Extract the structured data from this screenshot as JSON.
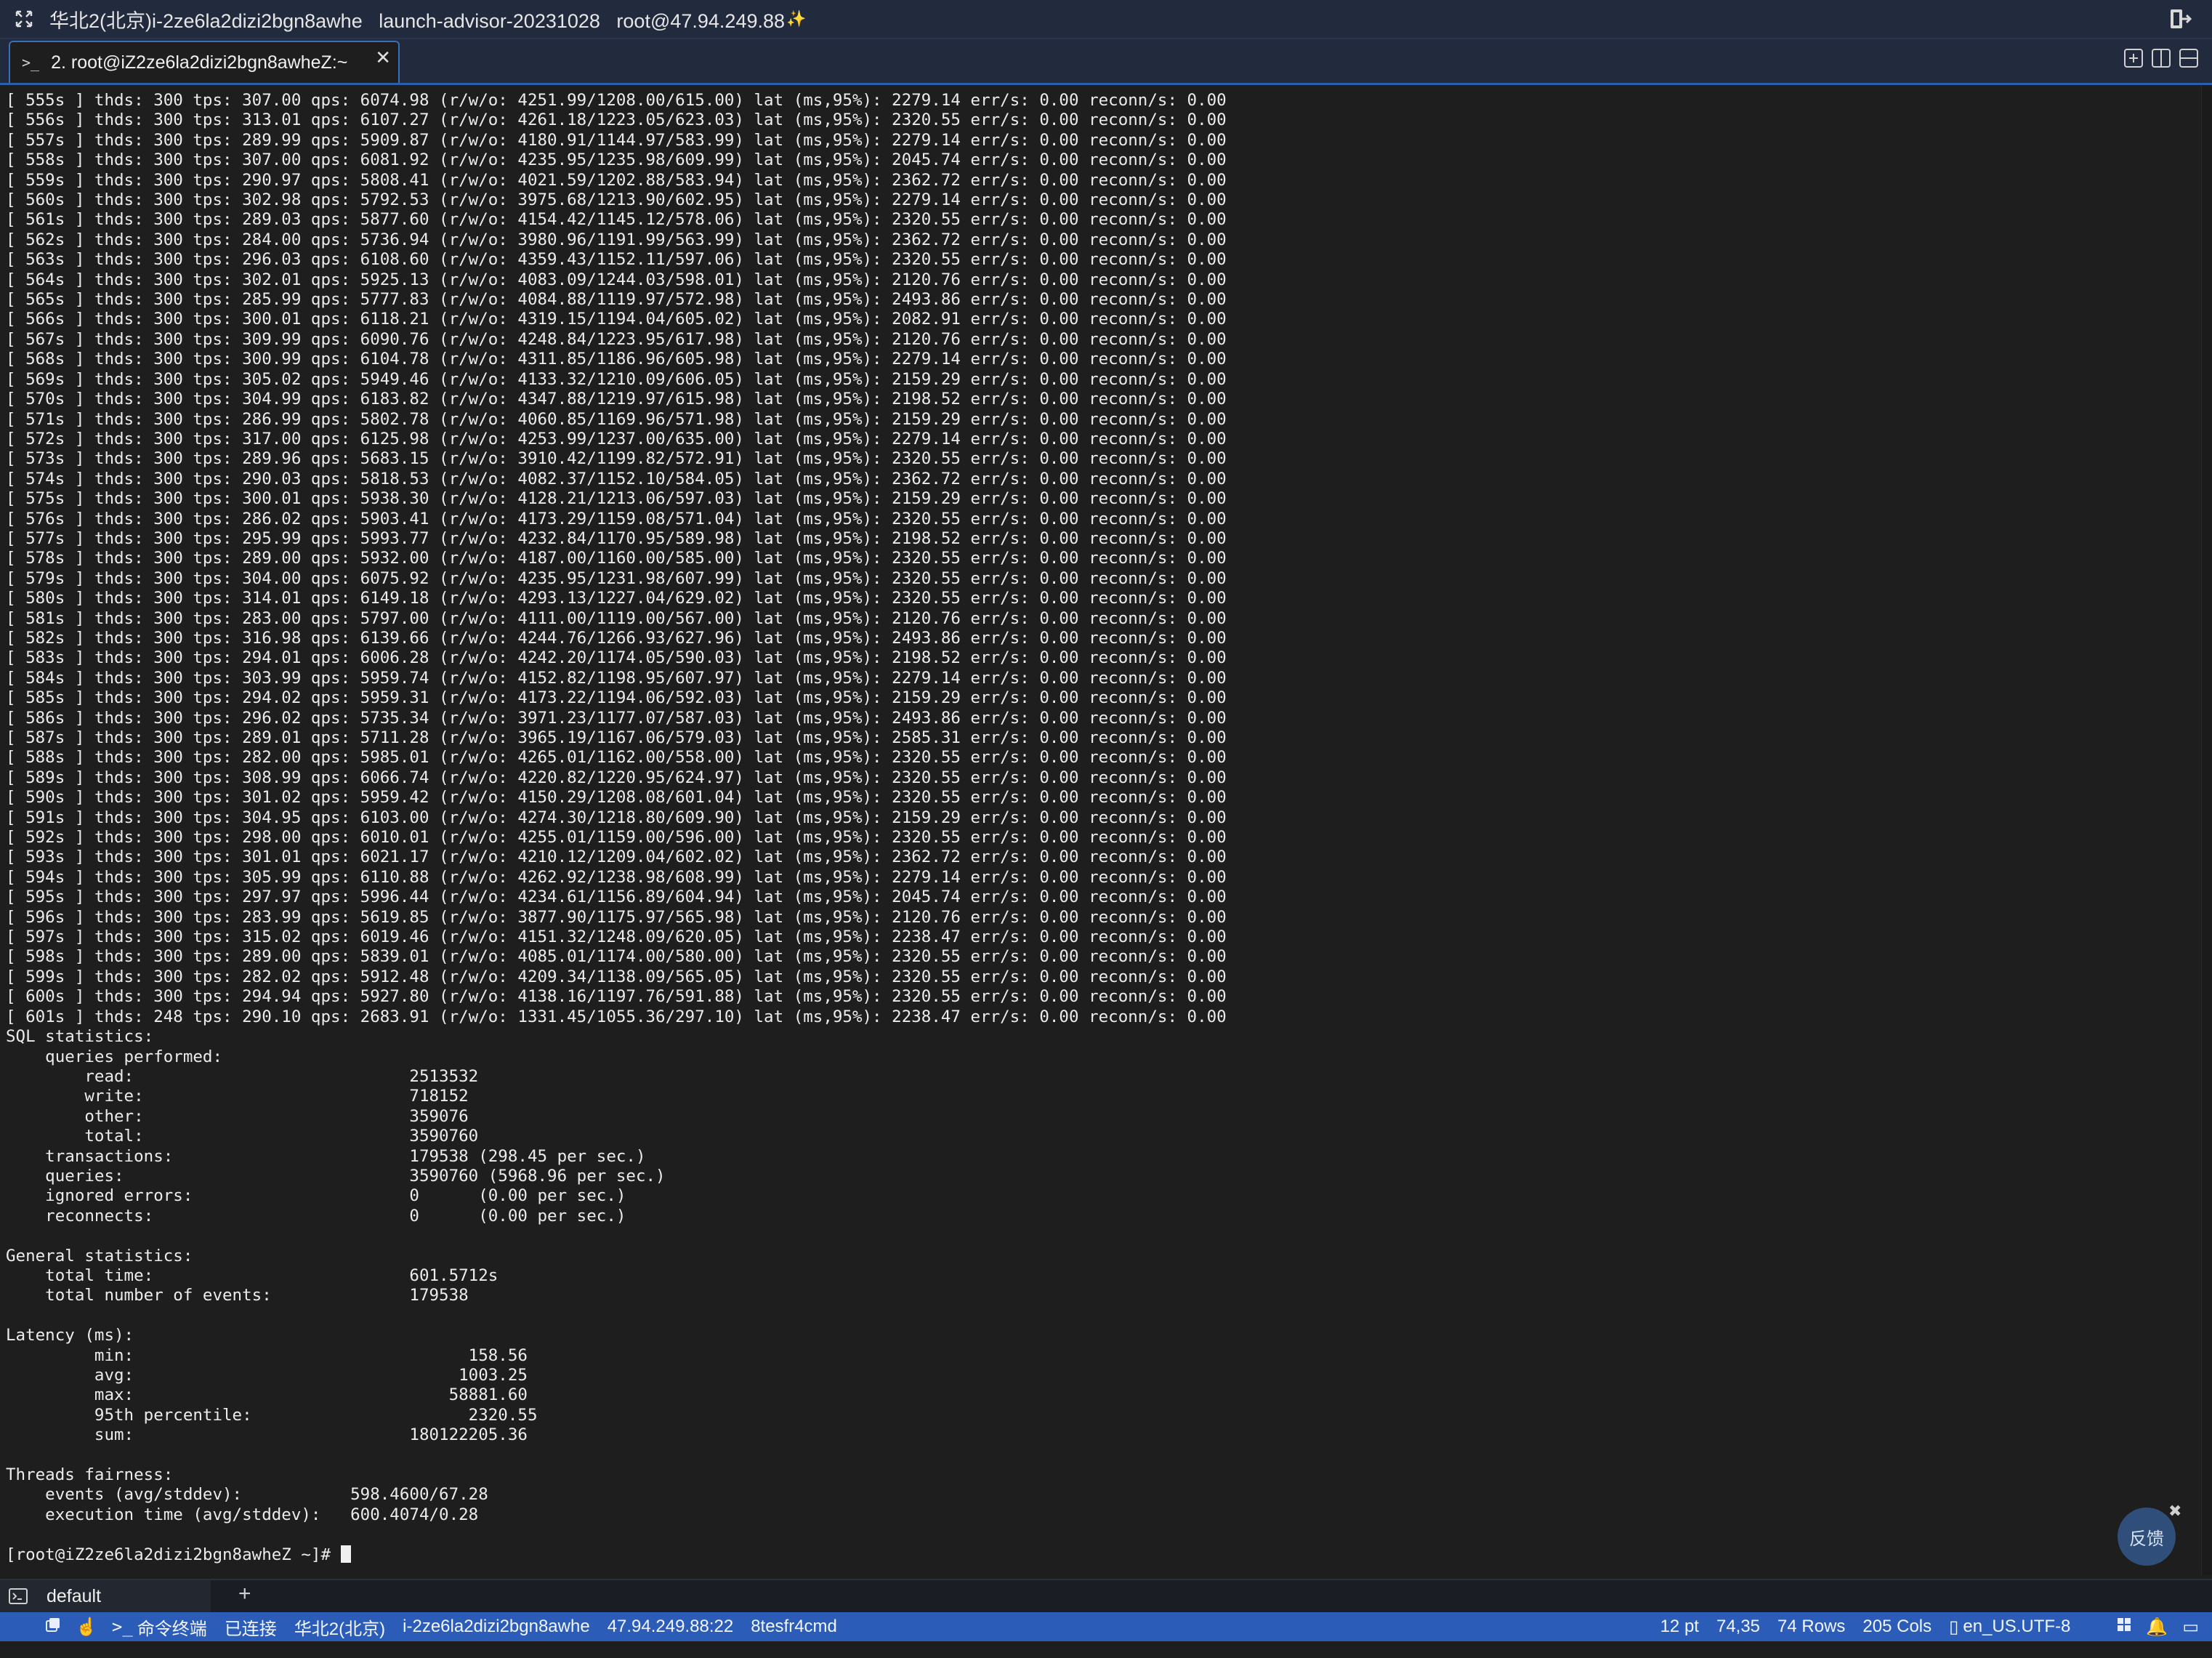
{
  "window": {
    "title": "华北2(北京)i-2ze6la2dizi2bgn8awhe   launch-advisor-20231028   root@47.94.249.88"
  },
  "tabs": [
    {
      "label": "2. root@iZ2ze6la2dizi2bgn8awheZ:~",
      "active": true
    }
  ],
  "terminal": {
    "lines": [
      "[ 555s ] thds: 300 tps: 307.00 qps: 6074.98 (r/w/o: 4251.99/1208.00/615.00) lat (ms,95%): 2279.14 err/s: 0.00 reconn/s: 0.00",
      "[ 556s ] thds: 300 tps: 313.01 qps: 6107.27 (r/w/o: 4261.18/1223.05/623.03) lat (ms,95%): 2320.55 err/s: 0.00 reconn/s: 0.00",
      "[ 557s ] thds: 300 tps: 289.99 qps: 5909.87 (r/w/o: 4180.91/1144.97/583.99) lat (ms,95%): 2279.14 err/s: 0.00 reconn/s: 0.00",
      "[ 558s ] thds: 300 tps: 307.00 qps: 6081.92 (r/w/o: 4235.95/1235.98/609.99) lat (ms,95%): 2045.74 err/s: 0.00 reconn/s: 0.00",
      "[ 559s ] thds: 300 tps: 290.97 qps: 5808.41 (r/w/o: 4021.59/1202.88/583.94) lat (ms,95%): 2362.72 err/s: 0.00 reconn/s: 0.00",
      "[ 560s ] thds: 300 tps: 302.98 qps: 5792.53 (r/w/o: 3975.68/1213.90/602.95) lat (ms,95%): 2279.14 err/s: 0.00 reconn/s: 0.00",
      "[ 561s ] thds: 300 tps: 289.03 qps: 5877.60 (r/w/o: 4154.42/1145.12/578.06) lat (ms,95%): 2320.55 err/s: 0.00 reconn/s: 0.00",
      "[ 562s ] thds: 300 tps: 284.00 qps: 5736.94 (r/w/o: 3980.96/1191.99/563.99) lat (ms,95%): 2362.72 err/s: 0.00 reconn/s: 0.00",
      "[ 563s ] thds: 300 tps: 296.03 qps: 6108.60 (r/w/o: 4359.43/1152.11/597.06) lat (ms,95%): 2320.55 err/s: 0.00 reconn/s: 0.00",
      "[ 564s ] thds: 300 tps: 302.01 qps: 5925.13 (r/w/o: 4083.09/1244.03/598.01) lat (ms,95%): 2120.76 err/s: 0.00 reconn/s: 0.00",
      "[ 565s ] thds: 300 tps: 285.99 qps: 5777.83 (r/w/o: 4084.88/1119.97/572.98) lat (ms,95%): 2493.86 err/s: 0.00 reconn/s: 0.00",
      "[ 566s ] thds: 300 tps: 300.01 qps: 6118.21 (r/w/o: 4319.15/1194.04/605.02) lat (ms,95%): 2082.91 err/s: 0.00 reconn/s: 0.00",
      "[ 567s ] thds: 300 tps: 309.99 qps: 6090.76 (r/w/o: 4248.84/1223.95/617.98) lat (ms,95%): 2120.76 err/s: 0.00 reconn/s: 0.00",
      "[ 568s ] thds: 300 tps: 300.99 qps: 6104.78 (r/w/o: 4311.85/1186.96/605.98) lat (ms,95%): 2279.14 err/s: 0.00 reconn/s: 0.00",
      "[ 569s ] thds: 300 tps: 305.02 qps: 5949.46 (r/w/o: 4133.32/1210.09/606.05) lat (ms,95%): 2159.29 err/s: 0.00 reconn/s: 0.00",
      "[ 570s ] thds: 300 tps: 304.99 qps: 6183.82 (r/w/o: 4347.88/1219.97/615.98) lat (ms,95%): 2198.52 err/s: 0.00 reconn/s: 0.00",
      "[ 571s ] thds: 300 tps: 286.99 qps: 5802.78 (r/w/o: 4060.85/1169.96/571.98) lat (ms,95%): 2159.29 err/s: 0.00 reconn/s: 0.00",
      "[ 572s ] thds: 300 tps: 317.00 qps: 6125.98 (r/w/o: 4253.99/1237.00/635.00) lat (ms,95%): 2279.14 err/s: 0.00 reconn/s: 0.00",
      "[ 573s ] thds: 300 tps: 289.96 qps: 5683.15 (r/w/o: 3910.42/1199.82/572.91) lat (ms,95%): 2320.55 err/s: 0.00 reconn/s: 0.00",
      "[ 574s ] thds: 300 tps: 290.03 qps: 5818.53 (r/w/o: 4082.37/1152.10/584.05) lat (ms,95%): 2362.72 err/s: 0.00 reconn/s: 0.00",
      "[ 575s ] thds: 300 tps: 300.01 qps: 5938.30 (r/w/o: 4128.21/1213.06/597.03) lat (ms,95%): 2159.29 err/s: 0.00 reconn/s: 0.00",
      "[ 576s ] thds: 300 tps: 286.02 qps: 5903.41 (r/w/o: 4173.29/1159.08/571.04) lat (ms,95%): 2320.55 err/s: 0.00 reconn/s: 0.00",
      "[ 577s ] thds: 300 tps: 295.99 qps: 5993.77 (r/w/o: 4232.84/1170.95/589.98) lat (ms,95%): 2198.52 err/s: 0.00 reconn/s: 0.00",
      "[ 578s ] thds: 300 tps: 289.00 qps: 5932.00 (r/w/o: 4187.00/1160.00/585.00) lat (ms,95%): 2320.55 err/s: 0.00 reconn/s: 0.00",
      "[ 579s ] thds: 300 tps: 304.00 qps: 6075.92 (r/w/o: 4235.95/1231.98/607.99) lat (ms,95%): 2320.55 err/s: 0.00 reconn/s: 0.00",
      "[ 580s ] thds: 300 tps: 314.01 qps: 6149.18 (r/w/o: 4293.13/1227.04/629.02) lat (ms,95%): 2320.55 err/s: 0.00 reconn/s: 0.00",
      "[ 581s ] thds: 300 tps: 283.00 qps: 5797.00 (r/w/o: 4111.00/1119.00/567.00) lat (ms,95%): 2120.76 err/s: 0.00 reconn/s: 0.00",
      "[ 582s ] thds: 300 tps: 316.98 qps: 6139.66 (r/w/o: 4244.76/1266.93/627.96) lat (ms,95%): 2493.86 err/s: 0.00 reconn/s: 0.00",
      "[ 583s ] thds: 300 tps: 294.01 qps: 6006.28 (r/w/o: 4242.20/1174.05/590.03) lat (ms,95%): 2198.52 err/s: 0.00 reconn/s: 0.00",
      "[ 584s ] thds: 300 tps: 303.99 qps: 5959.74 (r/w/o: 4152.82/1198.95/607.97) lat (ms,95%): 2279.14 err/s: 0.00 reconn/s: 0.00",
      "[ 585s ] thds: 300 tps: 294.02 qps: 5959.31 (r/w/o: 4173.22/1194.06/592.03) lat (ms,95%): 2159.29 err/s: 0.00 reconn/s: 0.00",
      "[ 586s ] thds: 300 tps: 296.02 qps: 5735.34 (r/w/o: 3971.23/1177.07/587.03) lat (ms,95%): 2493.86 err/s: 0.00 reconn/s: 0.00",
      "[ 587s ] thds: 300 tps: 289.01 qps: 5711.28 (r/w/o: 3965.19/1167.06/579.03) lat (ms,95%): 2585.31 err/s: 0.00 reconn/s: 0.00",
      "[ 588s ] thds: 300 tps: 282.00 qps: 5985.01 (r/w/o: 4265.01/1162.00/558.00) lat (ms,95%): 2320.55 err/s: 0.00 reconn/s: 0.00",
      "[ 589s ] thds: 300 tps: 308.99 qps: 6066.74 (r/w/o: 4220.82/1220.95/624.97) lat (ms,95%): 2320.55 err/s: 0.00 reconn/s: 0.00",
      "[ 590s ] thds: 300 tps: 301.02 qps: 5959.42 (r/w/o: 4150.29/1208.08/601.04) lat (ms,95%): 2320.55 err/s: 0.00 reconn/s: 0.00",
      "[ 591s ] thds: 300 tps: 304.95 qps: 6103.00 (r/w/o: 4274.30/1218.80/609.90) lat (ms,95%): 2159.29 err/s: 0.00 reconn/s: 0.00",
      "[ 592s ] thds: 300 tps: 298.00 qps: 6010.01 (r/w/o: 4255.01/1159.00/596.00) lat (ms,95%): 2320.55 err/s: 0.00 reconn/s: 0.00",
      "[ 593s ] thds: 300 tps: 301.01 qps: 6021.17 (r/w/o: 4210.12/1209.04/602.02) lat (ms,95%): 2362.72 err/s: 0.00 reconn/s: 0.00",
      "[ 594s ] thds: 300 tps: 305.99 qps: 6110.88 (r/w/o: 4262.92/1238.98/608.99) lat (ms,95%): 2279.14 err/s: 0.00 reconn/s: 0.00",
      "[ 595s ] thds: 300 tps: 297.97 qps: 5996.44 (r/w/o: 4234.61/1156.89/604.94) lat (ms,95%): 2045.74 err/s: 0.00 reconn/s: 0.00",
      "[ 596s ] thds: 300 tps: 283.99 qps: 5619.85 (r/w/o: 3877.90/1175.97/565.98) lat (ms,95%): 2120.76 err/s: 0.00 reconn/s: 0.00",
      "[ 597s ] thds: 300 tps: 315.02 qps: 6019.46 (r/w/o: 4151.32/1248.09/620.05) lat (ms,95%): 2238.47 err/s: 0.00 reconn/s: 0.00",
      "[ 598s ] thds: 300 tps: 289.00 qps: 5839.01 (r/w/o: 4085.01/1174.00/580.00) lat (ms,95%): 2320.55 err/s: 0.00 reconn/s: 0.00",
      "[ 599s ] thds: 300 tps: 282.02 qps: 5912.48 (r/w/o: 4209.34/1138.09/565.05) lat (ms,95%): 2320.55 err/s: 0.00 reconn/s: 0.00",
      "[ 600s ] thds: 300 tps: 294.94 qps: 5927.80 (r/w/o: 4138.16/1197.76/591.88) lat (ms,95%): 2320.55 err/s: 0.00 reconn/s: 0.00",
      "[ 601s ] thds: 248 tps: 290.10 qps: 2683.91 (r/w/o: 1331.45/1055.36/297.10) lat (ms,95%): 2238.47 err/s: 0.00 reconn/s: 0.00",
      "SQL statistics:",
      "    queries performed:",
      "        read:                            2513532",
      "        write:                           718152",
      "        other:                           359076",
      "        total:                           3590760",
      "    transactions:                        179538 (298.45 per sec.)",
      "    queries:                             3590760 (5968.96 per sec.)",
      "    ignored errors:                      0      (0.00 per sec.)",
      "    reconnects:                          0      (0.00 per sec.)",
      "",
      "General statistics:",
      "    total time:                          601.5712s",
      "    total number of events:              179538",
      "",
      "Latency (ms):",
      "         min:                                  158.56",
      "         avg:                                 1003.25",
      "         max:                                58881.60",
      "         95th percentile:                      2320.55",
      "         sum:                            180122205.36",
      "",
      "Threads fairness:",
      "    events (avg/stddev):           598.4600/67.28",
      "    execution time (avg/stddev):   600.4074/0.28",
      ""
    ],
    "prompt": "[root@iZ2ze6la2dizi2bgn8awheZ ~]# "
  },
  "feedback": {
    "label": "反馈"
  },
  "session_bar": {
    "tab_label": "default",
    "add_label": "+"
  },
  "status_bar": {
    "left": [
      "命令终端",
      "已连接",
      "华北2(北京)",
      "i-2ze6la2dizi2bgn8awhe",
      "47.94.249.88:22",
      "8tesfr4cmd"
    ],
    "right": [
      "12 pt",
      "74,35",
      "74 Rows",
      "205 Cols",
      "en_US.UTF-8"
    ]
  },
  "colors": {
    "accent": "#2b5db8",
    "background": "#1e1e1e",
    "titlebar": "#222a3d"
  }
}
